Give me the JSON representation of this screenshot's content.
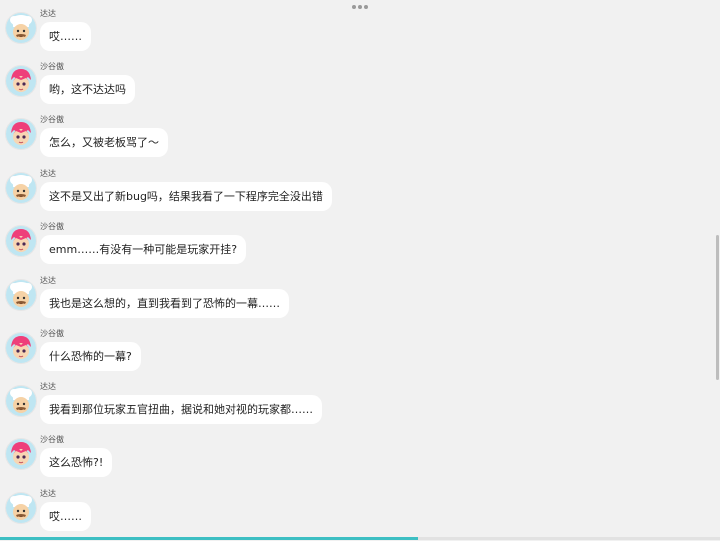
{
  "colors": {
    "background": "#f1f1f1",
    "bubble": "#ffffff",
    "progress": "#3dbfc3"
  },
  "icons": {
    "menu": "more-horizontal-icon",
    "dada_avatar": "chef-avatar-icon",
    "shagu_avatar": "pink-hair-avatar-icon"
  },
  "messages": [
    {
      "sender": "达达",
      "avatar": "dada",
      "text": "哎……"
    },
    {
      "sender": "沙谷傲",
      "avatar": "shagu",
      "text": "哟，这不达达吗"
    },
    {
      "sender": "沙谷傲",
      "avatar": "shagu",
      "text": "怎么，又被老板骂了～"
    },
    {
      "sender": "达达",
      "avatar": "dada",
      "text": "这不是又出了新bug吗，结果我看了一下程序完全没出错"
    },
    {
      "sender": "沙谷傲",
      "avatar": "shagu",
      "text": "emm……有没有一种可能是玩家开挂?"
    },
    {
      "sender": "达达",
      "avatar": "dada",
      "text": "我也是这么想的，直到我看到了恐怖的一幕……"
    },
    {
      "sender": "沙谷傲",
      "avatar": "shagu",
      "text": "什么恐怖的一幕?"
    },
    {
      "sender": "达达",
      "avatar": "dada",
      "text": "我看到那位玩家五官扭曲，据说和她对视的玩家都……"
    },
    {
      "sender": "沙谷傲",
      "avatar": "shagu",
      "text": "这么恐怖?!"
    },
    {
      "sender": "达达",
      "avatar": "dada",
      "text": "哎……"
    }
  ],
  "progress": {
    "fraction": 0.58
  }
}
